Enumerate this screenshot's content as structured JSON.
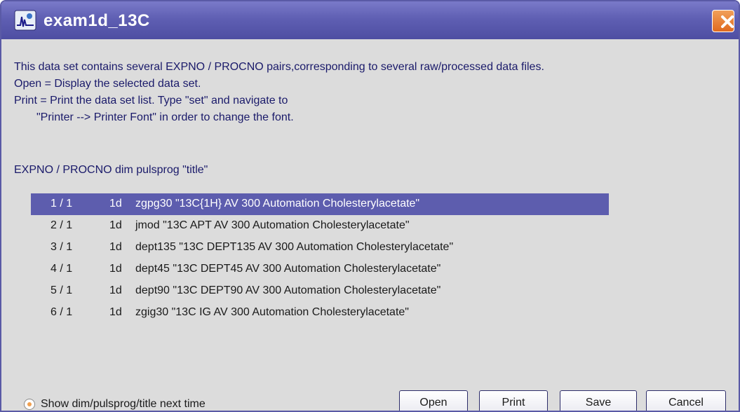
{
  "window": {
    "title": "exam1d_13C"
  },
  "info_lines": [
    "This data set contains several EXPNO / PROCNO pairs,corresponding to several raw/processed data files.",
    "Open = Display the selected data set.",
    "Print = Print the data set list. Type \"set\" and navigate to",
    "\"Printer --> Printer Font\" in order to change the font."
  ],
  "list_header": "EXPNO / PROCNO   dim pulsprog \"title\"",
  "rows": [
    {
      "expno": "1 / 1",
      "dim": "1d",
      "rest": "zgpg30  \"13C{1H}    AV 300 Automation    Cholesterylacetate\"",
      "selected": true
    },
    {
      "expno": "2 / 1",
      "dim": "1d",
      "rest": "jmod  \"13C APT    AV 300 Automation    Cholesterylacetate\"",
      "selected": false
    },
    {
      "expno": "3 / 1",
      "dim": "1d",
      "rest": "dept135  \"13C DEPT135    AV 300 Automation    Cholesterylacetate\"",
      "selected": false
    },
    {
      "expno": "4 / 1",
      "dim": "1d",
      "rest": "dept45  \"13C DEPT45    AV 300 Automation    Cholesterylacetate\"",
      "selected": false
    },
    {
      "expno": "5 / 1",
      "dim": "1d",
      "rest": "dept90  \"13C DEPT90    AV 300 Automation    Cholesterylacetate\"",
      "selected": false
    },
    {
      "expno": "6 / 1",
      "dim": "1d",
      "rest": "zgig30  \"13C IG    AV 300 Automation    Cholesterylacetate\"",
      "selected": false
    }
  ],
  "show_option": {
    "label": "Show dim/pulsprog/title next time",
    "checked": true
  },
  "buttons": {
    "open": "Open",
    "print": "Print",
    "save": "Save",
    "cancel": "Cancel"
  },
  "icons": {
    "app": "topspin-app-icon",
    "close": "close-icon",
    "radio": "radio-icon"
  },
  "colors": {
    "titlebar": "#5f5fb3",
    "selection": "#5d5dae",
    "close": "#e06a1f"
  }
}
